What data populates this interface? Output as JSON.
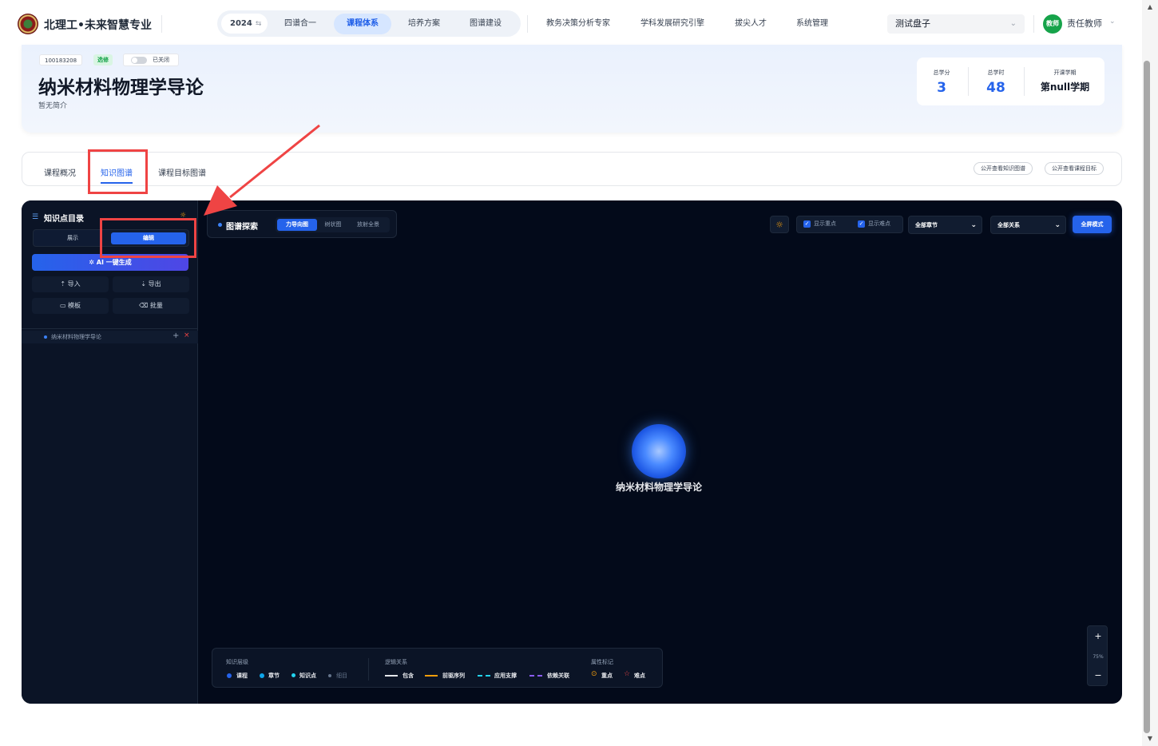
{
  "topbar": {
    "brand": "北理工•未来智慧专业",
    "year": "2024",
    "year_switch_icon": "swap-icon",
    "nav_pill_items": [
      "四谱合一",
      "课程体系",
      "培养方案",
      "图谱建设"
    ],
    "active_nav": "课程体系",
    "nav_items": [
      "教务决策分析专家",
      "学科发展研究引擎",
      "拔尖人才",
      "系统管理"
    ],
    "context_select": "测试盘子",
    "user_role_badge": "教师",
    "user_name": "责任教师"
  },
  "course": {
    "code": "100183208",
    "type": "选修",
    "toggle_label": "已关闭",
    "title": "纳米材料物理学导论",
    "intro": "暂无简介",
    "stats": [
      {
        "label": "总学分",
        "value": "3"
      },
      {
        "label": "总学时",
        "value": "48"
      },
      {
        "label": "开课学期",
        "value": "第null学期"
      }
    ]
  },
  "tabs": {
    "items": [
      "课程概况",
      "知识图谱",
      "课程目标图谱"
    ],
    "active": "知识图谱",
    "public_buttons": [
      "公开查看知识图谱",
      "公开查看课程目标"
    ]
  },
  "sidebar": {
    "title": "知识点目录",
    "mode_tabs": [
      "展示",
      "编辑"
    ],
    "active_mode": "编辑",
    "ai_button": "AI 一键生成",
    "actions": [
      "导入",
      "导出",
      "模板",
      "批量"
    ],
    "tree": [
      {
        "label": "纳米材料物理学导论"
      }
    ]
  },
  "graph": {
    "explore_title": "图谱探索",
    "views": [
      "力导向图",
      "树状图",
      "放射全景"
    ],
    "active_view": "力导向图",
    "checkboxes": [
      "显示重点",
      "显示难点"
    ],
    "chapter_filter": "全部章节",
    "relation_filter": "全部关系",
    "fullscreen_button": "全屏模式",
    "center_node": "纳米材料物理学导论",
    "zoom": "75%",
    "legend": {
      "level_title": "知识层级",
      "levels": [
        "课程",
        "章节",
        "知识点",
        "细目"
      ],
      "relation_title": "逻辑关系",
      "relations": [
        "包含",
        "前驱序列",
        "应用支撑",
        "依赖关联"
      ],
      "attr_title": "属性标记",
      "attrs": [
        "重点",
        "难点"
      ]
    }
  },
  "colors": {
    "accent": "#2563eb",
    "panel_bg": "#030a1a",
    "annotation": "#ef4444",
    "relation_prereq": "#f59e0b",
    "relation_support": "#22d3ee",
    "relation_depend": "#8b5cf6"
  }
}
